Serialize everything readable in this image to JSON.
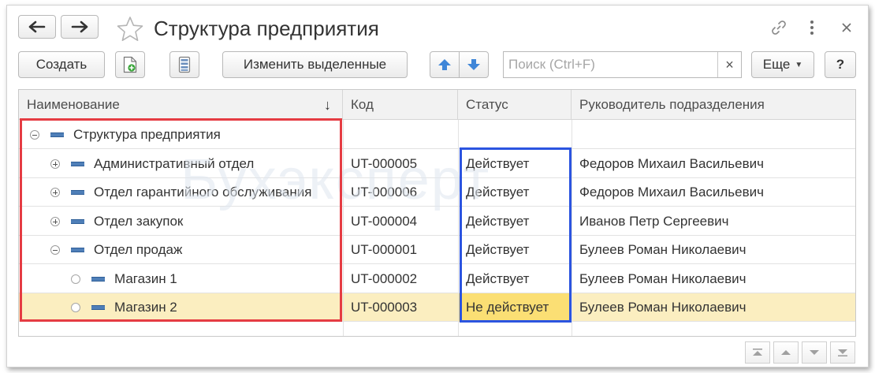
{
  "window": {
    "title": "Структура предприятия"
  },
  "toolbar": {
    "create_label": "Создать",
    "change_selected_label": "Изменить выделенные",
    "more_label": "Еще",
    "help_label": "?"
  },
  "search": {
    "placeholder": "Поиск (Ctrl+F)",
    "value": "",
    "clear_label": "×"
  },
  "table": {
    "columns": [
      {
        "label": "Наименование"
      },
      {
        "label": "Код"
      },
      {
        "label": "Статус"
      },
      {
        "label": "Руководитель подразделения"
      }
    ],
    "sort_indicator": "↓",
    "rows": [
      {
        "name": "Структура предприятия",
        "code": "",
        "status": "",
        "head": "",
        "level": 0,
        "node": "collapse"
      },
      {
        "name": "Административный отдел",
        "code": "UT-000005",
        "status": "Действует",
        "head": "Федоров Михаил Васильевич",
        "level": 1,
        "node": "expand"
      },
      {
        "name": "Отдел гарантийного обслуживания",
        "code": "UT-000006",
        "status": "Действует",
        "head": "Федоров Михаил Васильевич",
        "level": 1,
        "node": "expand"
      },
      {
        "name": "Отдел закупок",
        "code": "UT-000004",
        "status": "Действует",
        "head": "Иванов Петр Сергеевич",
        "level": 1,
        "node": "expand"
      },
      {
        "name": "Отдел продаж",
        "code": "UT-000001",
        "status": "Действует",
        "head": "Булеев Роман Николаевич",
        "level": 1,
        "node": "collapse"
      },
      {
        "name": "Магазин 1",
        "code": "UT-000002",
        "status": "Действует",
        "head": "Булеев Роман Николаевич",
        "level": 2,
        "node": "leaf"
      },
      {
        "name": "Магазин 2",
        "code": "UT-000003",
        "status": "Не действует",
        "head": "Булеев Роман Николаевич",
        "level": 2,
        "node": "leaf",
        "selected": true
      }
    ]
  },
  "watermark": "Бухэксперт",
  "colors": {
    "accent_blue": "#4f7fb8",
    "selected_row": "#fbeec0",
    "selected_cell": "#fbdf74",
    "highlight_red": "#e53c43",
    "highlight_blue": "#2b54e0"
  },
  "icons": {
    "back": "arrow-left-icon",
    "forward": "arrow-right-icon",
    "favorite": "star-icon",
    "link": "link-icon",
    "menu": "more-vertical-icon",
    "close": "close-icon",
    "add_copy": "add-document-icon",
    "list": "list-icon",
    "move_up": "arrow-up-icon",
    "move_down": "arrow-down-icon"
  }
}
